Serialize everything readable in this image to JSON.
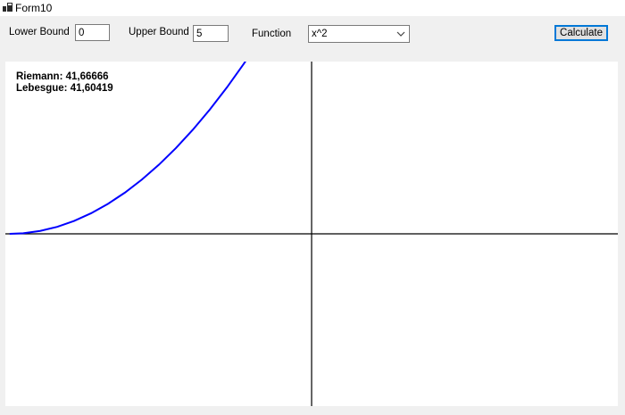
{
  "window": {
    "title": "Form10"
  },
  "controls": {
    "lower_bound_label": "Lower Bound",
    "lower_bound_value": "0",
    "upper_bound_label": "Upper Bound",
    "upper_bound_value": "5",
    "function_label": "Function",
    "function_selected": "x^2",
    "calculate_label": "Calculate"
  },
  "results": {
    "riemann": "Riemann: 41,66666",
    "lebesgue": "Lebesgue: 41,60419"
  },
  "icons": {
    "app": "form-app-icon",
    "dropdown": "chevron-down-icon"
  },
  "colors": {
    "curve": "#0000ff",
    "axes": "#000000",
    "plot_background": "#ffffff",
    "window_background": "#f0f0f0",
    "button_focus_border": "#0078d7"
  },
  "chart_data": {
    "type": "line",
    "function": "x^2",
    "series": [
      {
        "x": [
          -17.8,
          -17,
          -16,
          -15,
          -14,
          -13,
          -12,
          -11,
          -10,
          -9,
          -8,
          -7,
          -6,
          -5,
          -4,
          -3,
          -2,
          -1.4
        ],
        "y": [
          0,
          0.64,
          3.24,
          7.84,
          14.44,
          23.04,
          33.64,
          46.24,
          60.84,
          77.44,
          96.04,
          116.64,
          139.24,
          163.84,
          190.44,
          219.04,
          249.64,
          264
        ]
      }
    ]
  }
}
